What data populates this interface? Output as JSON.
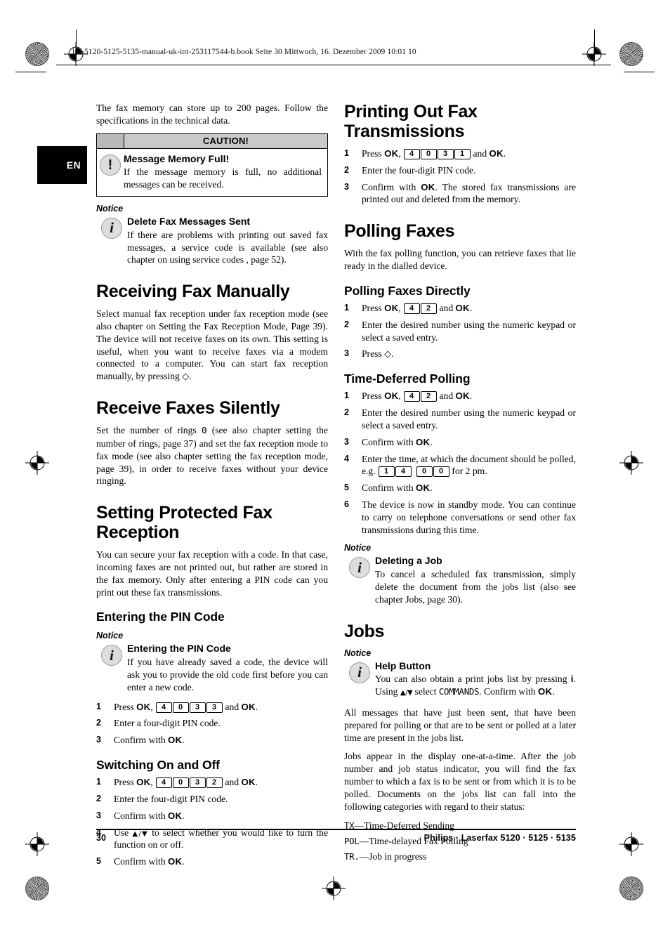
{
  "page": {
    "file_header": "lpf-5120-5125-5135-manual-uk-int-253117544-b.book   Seite 30   Mittwoch, 16. Dezember 2009   10:01 10",
    "language_tab": "EN",
    "footer_page_number": "30",
    "footer_product": "Philips · Laserfax 5120 · 5125 · 5135"
  },
  "left_column": {
    "intro": "The fax memory can store up to 200 pages. Follow the specifications in the technical data.",
    "caution": {
      "header": "CAUTION!",
      "title": "Message Memory Full!",
      "text": "If the message memory is full, no additional messages can be received.",
      "icon": "exclamation-circle-icon"
    },
    "notice_delete_fax": {
      "label": "Notice",
      "title": "Delete Fax Messages Sent",
      "text": "If there are problems with printing out saved fax messages, a service code is available (see also chapter on using service codes , page  52).",
      "icon": "info-circle-icon"
    },
    "receiving_fax_manually": {
      "heading": "Receiving Fax Manually",
      "text_part1": "Select manual fax reception under fax reception mode (see also chapter on Setting the Fax Reception Mode, Page 39). The device will not receive faxes on its own. This setting is useful, when you want to receive faxes via a modem connected to a computer. You can start fax reception manually, by pressing ",
      "start_glyph": "◇",
      "text_part2": "."
    },
    "receive_faxes_silently": {
      "heading": "Receive Faxes Silently",
      "text_part1": "Set the number of rings ",
      "rings_value": "0",
      "text_part2": " (see also chapter  setting the number of rings, page  37) and set the fax reception mode to fax mode (see also chapter  setting the fax reception mode, page  39),  in order to receive faxes without your device ringing."
    },
    "setting_protected_fax_reception": {
      "heading": "Setting Protected Fax Reception",
      "text": "You can secure your fax reception with a code. In that case, incoming faxes are not printed out, but rather are stored in the fax memory. Only after entering a PIN code can you print out these fax transmissions."
    },
    "entering_pin_code": {
      "heading": "Entering the PIN Code",
      "notice": {
        "label": "Notice",
        "title": "Entering the PIN Code",
        "text": "If you have already saved a code, the device will ask you to provide the old code first before you can enter a new code.",
        "icon": "info-circle-icon"
      },
      "steps": [
        {
          "num": "1",
          "pre": "Press ",
          "ok1": "OK",
          "comma": ", ",
          "keys": [
            "4",
            "0",
            "3",
            "3"
          ],
          "mid": " and ",
          "ok2": "OK",
          "post": "."
        },
        {
          "num": "2",
          "text": "Enter a four-digit PIN code."
        },
        {
          "num": "3",
          "pre": "Confirm with ",
          "ok1": "OK",
          "post": "."
        }
      ]
    },
    "switching_on_off": {
      "heading": "Switching On and Off",
      "steps": [
        {
          "num": "1",
          "pre": "Press ",
          "ok1": "OK",
          "comma": ", ",
          "keys": [
            "4",
            "0",
            "3",
            "2"
          ],
          "mid": " and ",
          "ok2": "OK",
          "post": "."
        },
        {
          "num": "2",
          "text": "Enter the four-digit PIN code."
        },
        {
          "num": "3",
          "pre": "Confirm with ",
          "ok1": "OK",
          "post": "."
        },
        {
          "num": "4",
          "pre": "Use ",
          "arrows": "▲/▼",
          "post": " to select whether you would like to turn the function on or off."
        },
        {
          "num": "5",
          "pre": "Confirm with ",
          "ok1": "OK",
          "post": "."
        }
      ]
    }
  },
  "right_column": {
    "printing_out_fax_transmissions": {
      "heading": "Printing Out Fax Transmissions",
      "steps": [
        {
          "num": "1",
          "pre": "Press ",
          "ok1": "OK",
          "comma": ", ",
          "keys": [
            "4",
            "0",
            "3",
            "1"
          ],
          "mid": " and ",
          "ok2": "OK",
          "post": "."
        },
        {
          "num": "2",
          "text": "Enter the four-digit PIN code."
        },
        {
          "num": "3",
          "pre": "Confirm with ",
          "ok1": "OK",
          "post": ". The stored fax transmissions are printed out and deleted from the memory."
        }
      ]
    },
    "polling_faxes": {
      "heading": "Polling Faxes",
      "text": "With the fax polling function, you can retrieve faxes that lie ready in the dialled device."
    },
    "polling_faxes_directly": {
      "heading": "Polling Faxes Directly",
      "steps": [
        {
          "num": "1",
          "pre": "Press ",
          "ok1": "OK",
          "comma": ", ",
          "keys": [
            "4",
            "2"
          ],
          "mid": " and ",
          "ok2": "OK",
          "post": "."
        },
        {
          "num": "2",
          "text": "Enter the desired number using the numeric keypad or select a saved entry."
        },
        {
          "num": "3",
          "pre": "Press ",
          "glyph": "◇",
          "post": "."
        }
      ]
    },
    "time_deferred_polling": {
      "heading": "Time-Deferred Polling",
      "steps": [
        {
          "num": "1",
          "pre": "Press ",
          "ok1": "OK",
          "comma": ", ",
          "keys": [
            "4",
            "2"
          ],
          "mid": " and ",
          "ok2": "OK",
          "post": "."
        },
        {
          "num": "2",
          "text": "Enter the desired number using the numeric keypad or select a saved entry."
        },
        {
          "num": "3",
          "pre": "Confirm with ",
          "ok1": "OK",
          "post": "."
        },
        {
          "num": "4",
          "pre": "Enter the time, at which the document should be polled, e.g. ",
          "keys_a": [
            "1",
            "4"
          ],
          "keys_b": [
            "0",
            "0"
          ],
          "post": " for 2 pm."
        },
        {
          "num": "5",
          "pre": "Confirm with ",
          "ok1": "OK",
          "post": "."
        },
        {
          "num": "6",
          "text": "The device is now in standby mode. You can continue to carry on telephone conversations or send other fax transmissions during this time."
        }
      ]
    },
    "notice_deleting_job": {
      "label": "Notice",
      "title": "Deleting a Job",
      "text": "To cancel a scheduled fax transmission, simply delete the document from the jobs list (also see chapter Jobs, page 30).",
      "icon": "info-circle-icon"
    },
    "jobs": {
      "heading": "Jobs",
      "notice": {
        "label": "Notice",
        "title": "Help Button",
        "icon": "info-circle-icon",
        "text_pre": "You can also obtain a print jobs list by pressing ",
        "help_key": "i",
        "text_mid": ". Using ",
        "arrows": "▲/▼",
        "text_mid2": " select ",
        "command": "COMMANDS",
        "text_mid3": ". Confirm with ",
        "ok": "OK",
        "text_post": "."
      },
      "paragraph1": "All messages that have just been sent, that have been prepared for polling or that are to be sent or polled at a later time are present in the jobs list.",
      "paragraph2": "Jobs appear in the display one-at-a-time. After the job number and job status indicator, you will find the fax number to which a fax is to be sent or from which it is to be polled. Documents on the jobs list can fall into the following categories with regard to their status:",
      "status_list": [
        {
          "code": "TX",
          "desc": "—Time-Deferred Sending"
        },
        {
          "code": "POL",
          "desc": "—Time-delayed Fax Polling"
        },
        {
          "code": "TR.",
          "desc": "—Job in progress"
        }
      ]
    }
  }
}
